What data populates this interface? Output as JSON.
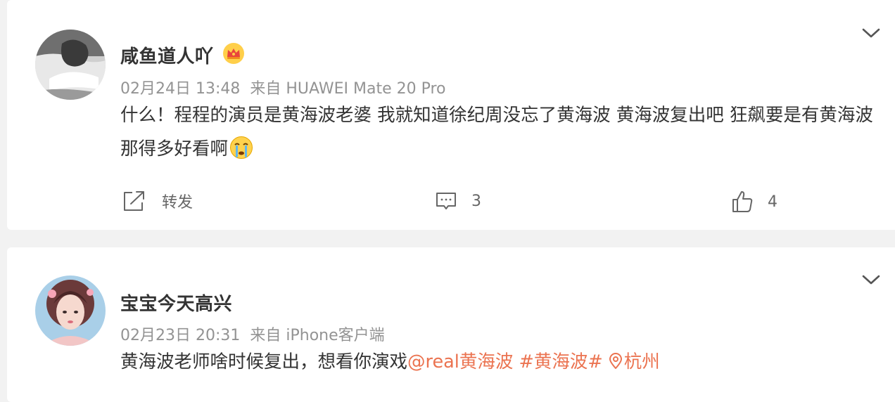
{
  "posts": [
    {
      "username": "咸鱼道人吖",
      "badge_icon": "crown-icon",
      "time": "02月24日 13:48",
      "source": "来自 HUAWEI Mate 20 Pro",
      "text": "什么！程程的演员是黄海波老婆 我就知道徐纪周没忘了黄海波 黄海波复出吧 狂飙要是有黄海波那得多好看啊",
      "text_emoji": "crying-emoji-icon",
      "actions": {
        "repost_label": "转发",
        "comment_count": "3",
        "like_count": "4"
      }
    },
    {
      "username": "宝宝今天高兴",
      "time": "02月23日 20:31",
      "source": "来自 iPhone客户端",
      "text": "黄海波老师啥时候复出，想看你演戏",
      "mention": "@real黄海波",
      "topic": "#黄海波#",
      "location_icon": "location-pin-icon",
      "location": "杭州"
    }
  ],
  "colors": {
    "page_bg": "#f2f2f2",
    "card_bg": "#ffffff",
    "text": "#333333",
    "meta": "#939393",
    "link": "#eb7350"
  }
}
